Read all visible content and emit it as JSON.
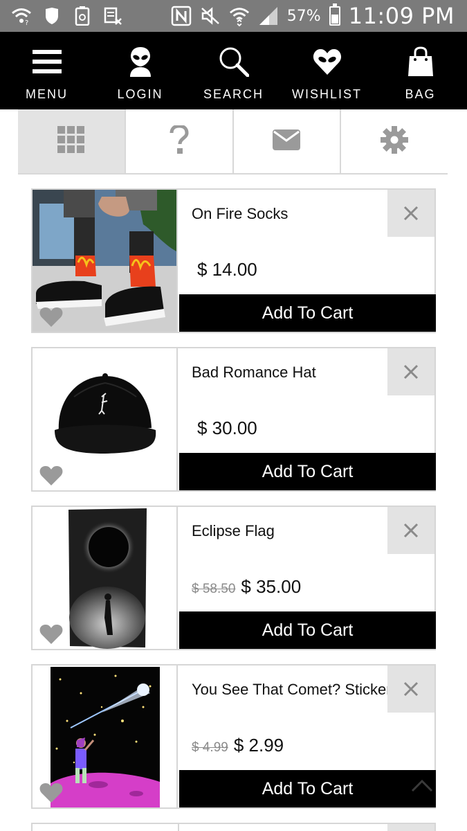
{
  "status_bar": {
    "battery_percent": "57%",
    "time": "11:09 PM",
    "icons": [
      "wifi-question-icon",
      "shield-icon",
      "recycle-icon",
      "data-off-icon",
      "nfc-icon",
      "mute-icon",
      "wifi-icon",
      "signal-icon",
      "battery-icon"
    ]
  },
  "nav": {
    "menu": "MENU",
    "login": "LOGIN",
    "search": "SEARCH",
    "wishlist": "WISHLIST",
    "bag": "BAG"
  },
  "sub_tabs": [
    "grid-icon",
    "question-icon",
    "mail-icon",
    "gear-icon"
  ],
  "colors": {
    "nav_bg": "#000000",
    "status_bg": "#7b7b7b",
    "button_bg": "#000000",
    "tab_active_bg": "#e3e3e3",
    "heart": "#9a9a9a"
  },
  "products": [
    {
      "name": "On Fire Socks",
      "old_price": "",
      "price": "$ 14.00",
      "button": "Add To Cart"
    },
    {
      "name": "Bad Romance Hat",
      "old_price": "",
      "price": "$ 30.00",
      "button": "Add To Cart"
    },
    {
      "name": "Eclipse Flag",
      "old_price": "$ 58.50",
      "price": "$ 35.00",
      "button": "Add To Cart"
    },
    {
      "name": "You See That Comet? Sticker",
      "old_price": "$ 4.99",
      "price": "$ 2.99",
      "button": "Add To Cart"
    }
  ]
}
